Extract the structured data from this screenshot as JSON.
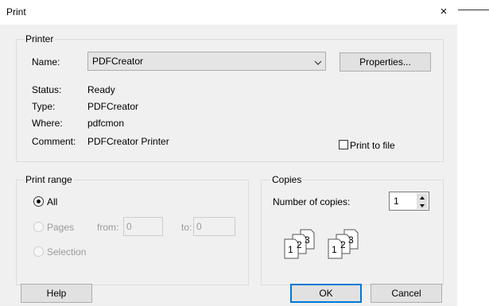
{
  "window": {
    "title": "Print",
    "close_glyph": "×"
  },
  "printer": {
    "group_label": "Printer",
    "name_label": "Name:",
    "name_value": "PDFCreator",
    "properties_label": "Properties...",
    "status_label": "Status:",
    "status_value": "Ready",
    "type_label": "Type:",
    "type_value": "PDFCreator",
    "where_label": "Where:",
    "where_value": "pdfcmon",
    "comment_label": "Comment:",
    "comment_value": "PDFCreator Printer",
    "print_to_file_label": "Print to file",
    "print_to_file_checked": false
  },
  "print_range": {
    "group_label": "Print range",
    "all_label": "All",
    "all_selected": true,
    "pages_label": "Pages",
    "from_label": "from:",
    "from_value": "0",
    "to_label": "to:",
    "to_value": "0",
    "selection_label": "Selection"
  },
  "copies": {
    "group_label": "Copies",
    "number_label": "Number of copies:",
    "number_value": "1",
    "collate_icon": "collate-pages-icon",
    "page_numbers": [
      "1",
      "2",
      "3"
    ]
  },
  "buttons": {
    "help": "Help",
    "ok": "OK",
    "cancel": "Cancel"
  },
  "colors": {
    "dialog_bg": "#f0f0f0",
    "default_button_border": "#0078d7",
    "disabled_text": "#9a9a9a"
  }
}
